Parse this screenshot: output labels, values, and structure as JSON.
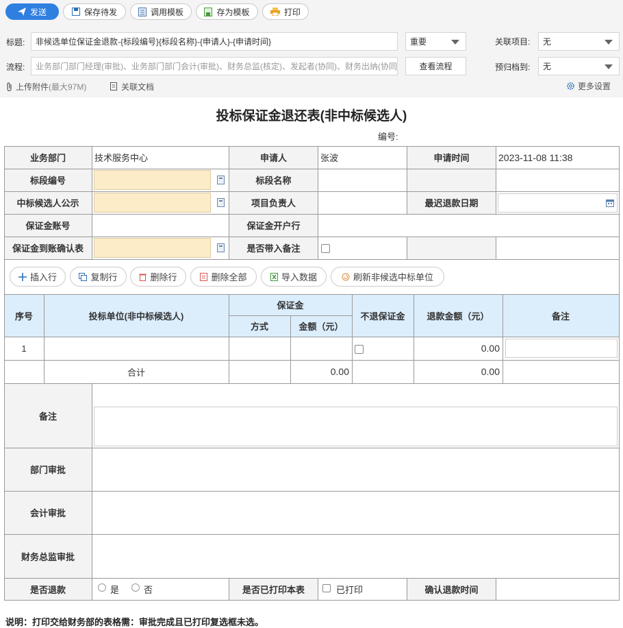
{
  "toolbar": {
    "send": "发送",
    "save_draft": "保存待发",
    "load_template": "调用模板",
    "save_template": "存为模板",
    "print": "打印",
    "send_icon": "paper-plane-icon",
    "save_icon": "floppy-icon",
    "template_icon": "document-icon",
    "save_tpl_icon": "save-template-icon",
    "print_icon": "printer-icon"
  },
  "header": {
    "title_label": "标题:",
    "title_value": "非候选单位保证金退款-{标段编号}{标段名称}-{申请人}-{申请时间}",
    "priority": "重要",
    "related_project_label": "关联项目:",
    "related_project_value": "无",
    "flow_label": "流程:",
    "flow_value": "业务部门部门经理(审批)、业务部门部门会计(审批)、财务总监(核定)、发起者(协同)、财务出纳(协同)",
    "view_flow": "查看流程",
    "archive_label": "预归档到:",
    "archive_value": "无",
    "upload": "上传附件",
    "upload_limit": "(最大97M)",
    "related_doc": "关联文档",
    "more_settings": "更多设置"
  },
  "form": {
    "title": "投标保证金退还表(非中标候选人)",
    "serial_label": "编号:",
    "dept_label": "业务部门",
    "dept_value": "技术服务中心",
    "applicant_label": "申请人",
    "applicant_value": "张波",
    "apply_time_label": "申请时间",
    "apply_time_value": "2023-11-08 11:38",
    "section_no_label": "标段编号",
    "section_name_label": "标段名称",
    "candidate_label": "中标候选人公示",
    "manager_label": "项目负责人",
    "refund_deadline_label": "最迟退款日期",
    "account_no_label": "保证金账号",
    "bank_label": "保证金开户行",
    "confirm_label": "保证金到账确认表",
    "with_note_label": "是否带入备注"
  },
  "row_buttons": {
    "insert": "插入行",
    "copy": "复制行",
    "delete": "删除行",
    "delete_all": "删除全部",
    "import": "导入数据",
    "refresh": "刷新非候选中标单位"
  },
  "table": {
    "h_index": "序号",
    "h_unit": "投标单位(非中标候选人)",
    "h_deposit": "保证金",
    "h_method": "方式",
    "h_amount": "金额（元）",
    "h_no_refund": "不退保证金",
    "h_refund_amount": "退款金额（元）",
    "h_note": "备注",
    "row1_index": "1",
    "row1_refund": "0.00",
    "total_label": "合计",
    "total_amount": "0.00",
    "total_refund": "0.00"
  },
  "approvals": {
    "note_label": "备注",
    "dept_approval": "部门审批",
    "accounting_approval": "会计审批",
    "cfo_approval": "财务总监审批",
    "refund_q": "是否退款",
    "yes": "是",
    "no": "否",
    "printed_q": "是否已打印本表",
    "printed": "已打印",
    "refund_time": "确认退款时间"
  },
  "footer_note": "说明：打印交给财务部的表格需：审批完成且已打印复选框未选。"
}
